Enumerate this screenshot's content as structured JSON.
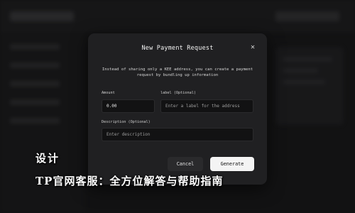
{
  "modal": {
    "title": "New Payment Request",
    "close_icon": "close-icon",
    "description": "Instead of sharing only a KEE address, you can create a payment request by bundling up information",
    "amount": {
      "label": "Amount",
      "value": "0.00"
    },
    "label_field": {
      "label": "label (Optional)",
      "placeholder": "Enter a label for the address"
    },
    "description_field": {
      "label": "Description (Optional)",
      "placeholder": "Enter description"
    },
    "cancel_label": "Cancel",
    "generate_label": "Generate"
  },
  "caption": {
    "line1": "设计",
    "line2": "TP官网客服：全方位解答与帮助指南"
  },
  "colors": {
    "modal_bg": "#202022",
    "page_bg": "#121213",
    "primary_button": "#f4f4f4"
  }
}
